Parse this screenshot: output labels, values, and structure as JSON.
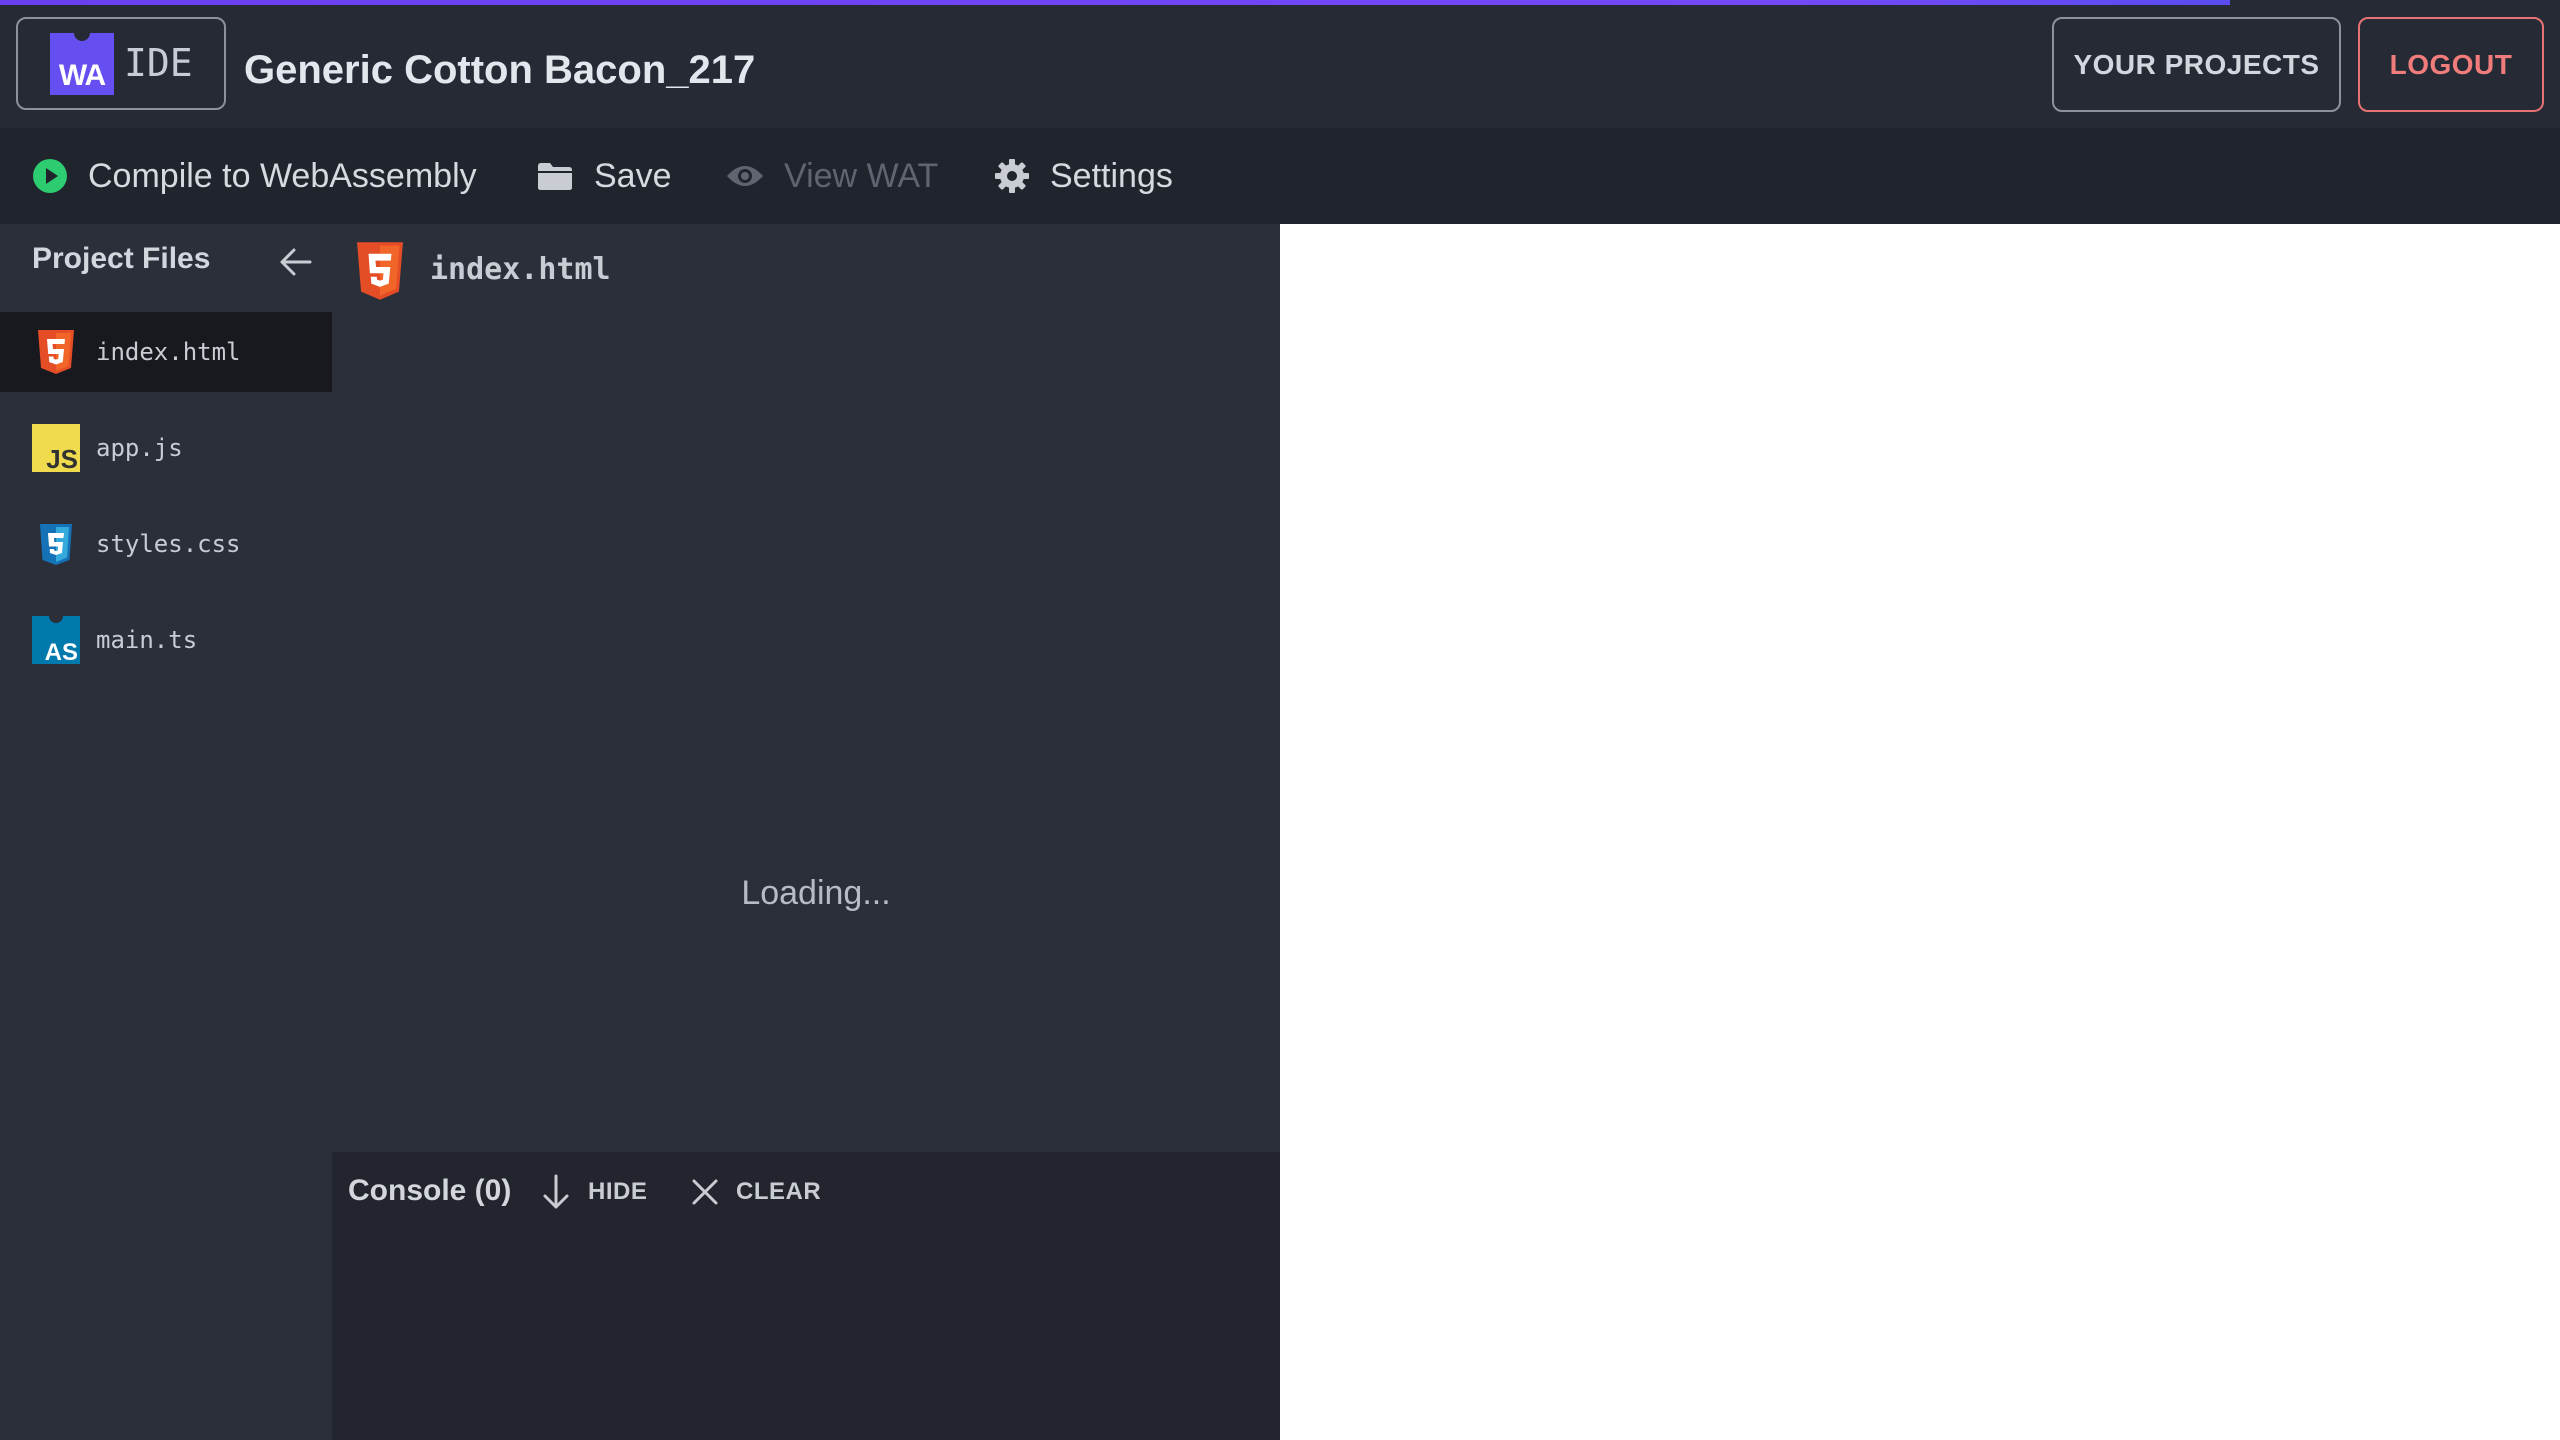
{
  "header": {
    "logo_mark": "WA",
    "logo_text": "IDE",
    "project_title": "Generic Cotton Bacon_217",
    "your_projects_label": "YOUR PROJECTS",
    "logout_label": "LOGOUT"
  },
  "toolbar": {
    "compile_label": "Compile to WebAssembly",
    "save_label": "Save",
    "view_wat_label": "View WAT",
    "settings_label": "Settings"
  },
  "sidebar": {
    "title": "Project Files",
    "files": [
      {
        "name": "index.html",
        "icon": "html5-icon",
        "active": true
      },
      {
        "name": "app.js",
        "icon": "js-icon",
        "active": false
      },
      {
        "name": "styles.css",
        "icon": "css3-icon",
        "active": false
      },
      {
        "name": "main.ts",
        "icon": "assemblyscript-icon",
        "active": false
      }
    ]
  },
  "editor": {
    "open_file": "index.html",
    "status": "Loading..."
  },
  "console": {
    "title": "Console (0)",
    "hide_label": "HIDE",
    "clear_label": "CLEAR"
  },
  "colors": {
    "accent": "#654ff0",
    "compile_green": "#2ecc71",
    "html_orange": "#e44d26",
    "js_yellow": "#f0db4f",
    "css_blue": "#1572b6",
    "as_blue": "#007aac",
    "logout_red": "#f07c7c"
  }
}
